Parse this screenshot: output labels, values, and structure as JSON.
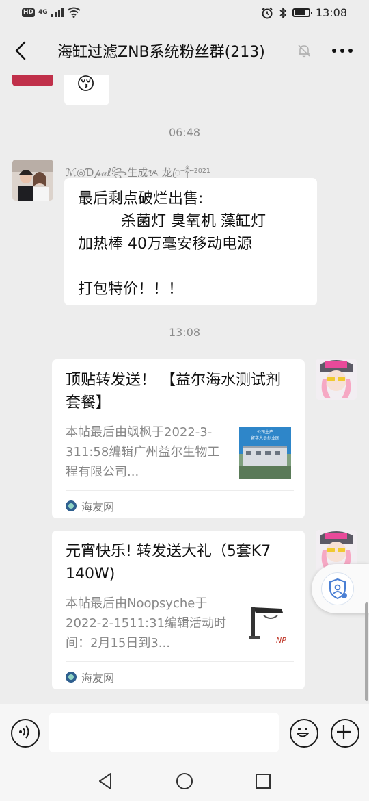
{
  "status_bar": {
    "network": "HD",
    "signal_label": "4G",
    "time": "13:08"
  },
  "header": {
    "title": "海缸过滤ZNB系统粉丝群(213)",
    "back_icon": "back-arrow-icon",
    "mute_icon": "bell-muted-icon",
    "more_icon": "more-dots-icon"
  },
  "chat": {
    "partial_message": {
      "emoji": "😚"
    },
    "timestamps": [
      "06:48",
      "13:08"
    ],
    "message1": {
      "sender": "ℳ◎Ɗ𝓅𝓊ℓ꧂生成ᝰ 龙ꦿ༒²⁰²¹",
      "text": "最后剩点破烂出售:\n         杀菌灯 臭氧机 藻缸灯\n加热棒 40万毫安移动电源\n\n打包特价！！！"
    },
    "card1": {
      "title": "顶贴转发送！ 【益尔海水测试剂套餐】",
      "description": "本帖最后由飒枫于2022-3-311:58编辑广州益尔生物工程有限公司...",
      "thumb_caption_1": "公司生产",
      "thumb_caption_2": "留学人员创业园",
      "source": "海友网"
    },
    "card2": {
      "title": "元宵快乐! 转发送大礼（5套K7  140W)",
      "description": "本帖最后由Noopsyche于2022-2-1511:31编辑活动时间：2月15日到3...",
      "thumb_label": "NP",
      "source": "海友网"
    }
  },
  "input_bar": {
    "voice_icon": "voice-icon",
    "emoji_icon": "emoji-smile-icon",
    "plus_icon": "plus-icon",
    "placeholder": ""
  },
  "colors": {
    "background": "#ededed",
    "bubble": "#ffffff",
    "secondary_text": "#888888"
  }
}
